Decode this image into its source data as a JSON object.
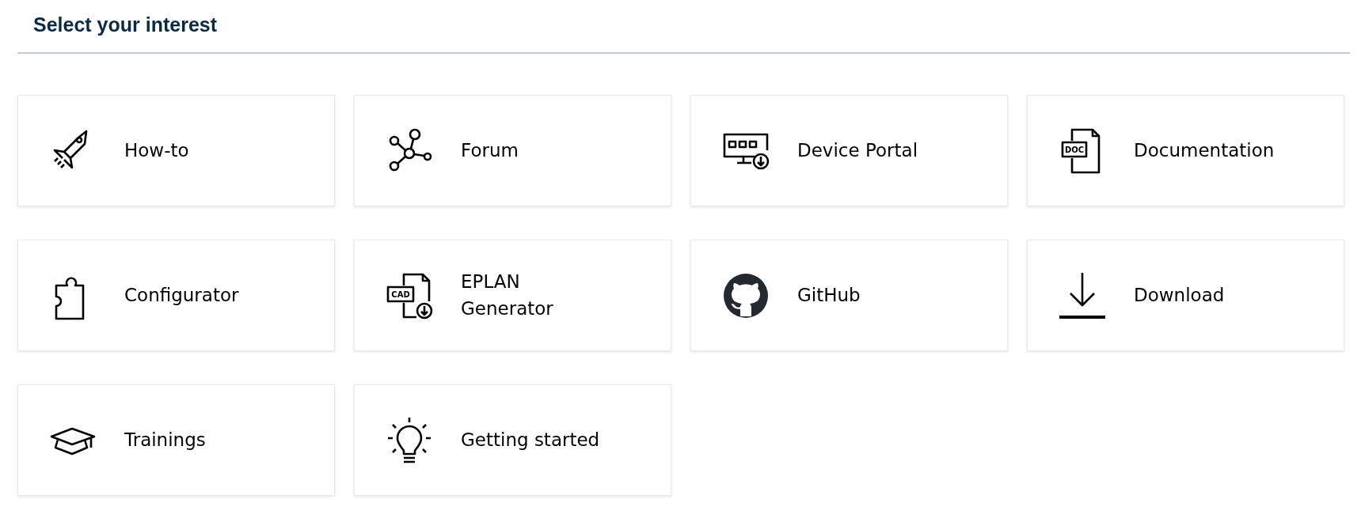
{
  "heading": "Select your interest",
  "tiles": [
    {
      "label": "How-to"
    },
    {
      "label": "Forum"
    },
    {
      "label": "Device Portal"
    },
    {
      "label": "Documentation",
      "icon_label": "DOC"
    },
    {
      "label": "Configurator"
    },
    {
      "label": "EPLAN Generator",
      "icon_label": "CAD"
    },
    {
      "label": "GitHub"
    },
    {
      "label": "Download"
    },
    {
      "label": "Trainings"
    },
    {
      "label": "Getting started"
    }
  ]
}
